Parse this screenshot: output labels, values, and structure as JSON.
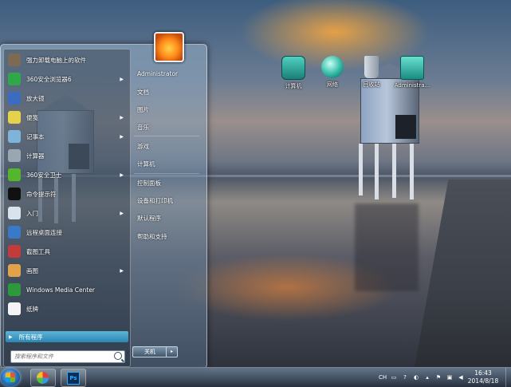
{
  "desktop_icons": [
    {
      "label": "计算机",
      "icon": "computer-icon"
    },
    {
      "label": "网络",
      "icon": "network-icon"
    },
    {
      "label": "回收站",
      "icon": "recycle-bin-icon"
    },
    {
      "label": "Administra...",
      "icon": "user-folder-icon"
    }
  ],
  "start_menu": {
    "pinned": [
      {
        "label": "强力卸载电脑上的软件",
        "icon": "uninstaller-icon",
        "color": "#7c6a53",
        "has_submenu": false
      },
      {
        "label": "360安全浏览器6",
        "icon": "360-browser-icon",
        "color": "#2fa84a",
        "has_submenu": true
      },
      {
        "label": "放大镜",
        "icon": "magnifier-icon",
        "color": "#3b6cc2",
        "has_submenu": false
      },
      {
        "label": "便笺",
        "icon": "sticky-notes-icon",
        "color": "#e5d24a",
        "has_submenu": true
      },
      {
        "label": "记事本",
        "icon": "notepad-icon",
        "color": "#7db4d8",
        "has_submenu": true
      },
      {
        "label": "计算器",
        "icon": "calculator-icon",
        "color": "#9aa6b2",
        "has_submenu": false
      },
      {
        "label": "360安全卫士",
        "icon": "360-safeguard-icon",
        "color": "#53b62c",
        "has_submenu": true
      },
      {
        "label": "命令提示符",
        "icon": "command-prompt-icon",
        "color": "#111111",
        "has_submenu": false
      },
      {
        "label": "入门",
        "icon": "getting-started-icon",
        "color": "#d9e3ee",
        "has_submenu": true
      },
      {
        "label": "远程桌面连接",
        "icon": "remote-desktop-icon",
        "color": "#3a78c8",
        "has_submenu": false
      },
      {
        "label": "截图工具",
        "icon": "snipping-tool-icon",
        "color": "#c43b3b",
        "has_submenu": false
      },
      {
        "label": "画图",
        "icon": "paint-icon",
        "color": "#e0a34a",
        "has_submenu": true
      },
      {
        "label": "Windows Media Center",
        "icon": "media-center-icon",
        "color": "#2c9a3a",
        "has_submenu": false
      },
      {
        "label": "纸牌",
        "icon": "solitaire-icon",
        "color": "#f4f4f4",
        "has_submenu": false
      }
    ],
    "all_programs": "所有程序",
    "search_placeholder": "搜索程序和文件",
    "user_name": "Administrator",
    "right_items": [
      "文档",
      "图片",
      "音乐",
      "游戏",
      "计算机",
      "控制面板",
      "设备和打印机",
      "默认程序",
      "帮助和支持"
    ],
    "shutdown_label": "关机",
    "shutdown_arrow": "▸"
  },
  "taskbar": {
    "apps": [
      {
        "name": "start-orb"
      },
      {
        "name": "360-app",
        "icon": "360-app-icon"
      },
      {
        "name": "photoshop",
        "icon": "photoshop-icon",
        "text": "Ps"
      }
    ],
    "tray_glyphs": [
      "CH",
      "▭",
      "?",
      "◐",
      "▴",
      "⚑",
      "▣",
      "◀"
    ],
    "time": "16:43",
    "date": "2014/8/18"
  },
  "colors": {
    "accent": "#2b86b3",
    "taskbar": "#2d3a4c"
  }
}
